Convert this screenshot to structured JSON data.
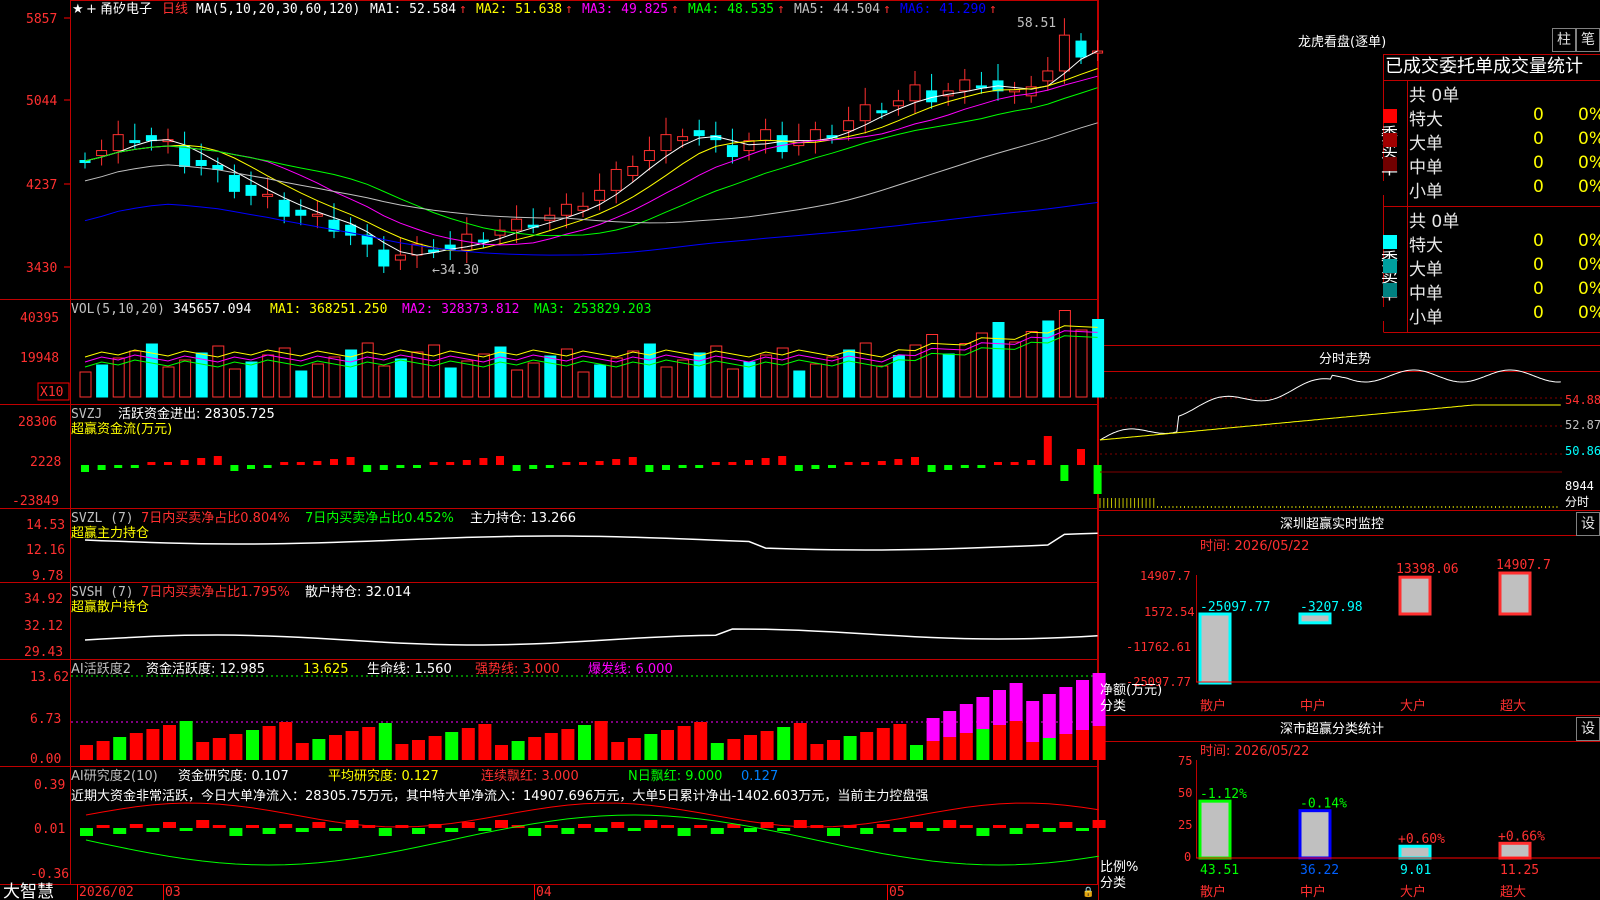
{
  "main": {
    "stock_name": "甬矽电子",
    "period": "日线",
    "indicator_label": "MA(5,10,20,30,60,120)",
    "ma": [
      {
        "label": "MA1: 52.584",
        "color": "#ffffff"
      },
      {
        "label": "MA2: 51.638",
        "color": "#ffff00"
      },
      {
        "label": "MA3: 49.825",
        "color": "#ff00ff"
      },
      {
        "label": "MA4: 48.535",
        "color": "#00ff00"
      },
      {
        "label": "MA5: 44.504",
        "color": "#c0c0c0"
      },
      {
        "label": "MA6: 41.290",
        "color": "#0000ff"
      }
    ],
    "y_labels": [
      "5857",
      "5044",
      "4237",
      "3430"
    ],
    "high_note": "58.51",
    "low_note": "←34.30"
  },
  "vol": {
    "title": "VOL(5,10,20)",
    "value": "345657.094",
    "ma": [
      {
        "label": "MA1: 368251.250",
        "color": "#ffff00"
      },
      {
        "label": "MA2: 328373.812",
        "color": "#ff00ff"
      },
      {
        "label": "MA3: 253829.203",
        "color": "#00ff00"
      }
    ],
    "y_labels": [
      "40395",
      "19948"
    ],
    "unit": "X10"
  },
  "svzj": {
    "title": "SVZJ",
    "label": "活跃资金进出: 28305.725",
    "subtitle": "超赢资金流(万元)",
    "y_labels": [
      "28306",
      "2228",
      "-23849"
    ]
  },
  "svzl": {
    "title": "SVZL (7)",
    "part1": "7日内买卖净占比0.804%",
    "part2": "7日内买卖净占比0.452%",
    "part3": "主力持仓: 13.266",
    "subtitle": "超赢主力持仓",
    "y_labels": [
      "14.53",
      "12.16",
      "9.78"
    ]
  },
  "svsh": {
    "title": "SVSH (7)",
    "part1": "7日内买卖净占比1.795%",
    "part2": "散户持仓: 32.014",
    "subtitle": "超赢散户持仓",
    "y_labels": [
      "34.92",
      "32.12",
      "29.43"
    ]
  },
  "ai1": {
    "title": "AI活跃度2",
    "p1": "资金活跃度: 12.985",
    "p2": "13.625",
    "p3": "生命线: 1.560",
    "p4": "强势线: 3.000",
    "p5": "爆发线: 6.000",
    "y_labels": [
      "13.62",
      "6.73",
      "0.00"
    ]
  },
  "ai2": {
    "title": "AI研究度2(10)",
    "p1": "资金研究度: 0.107",
    "p2": "平均研究度: 0.127",
    "p3": "连续飘红: 3.000",
    "p4": "N日飘红: 9.000",
    "p5": "0.127",
    "summary": "近期大资金非常活跃，今日大单净流入：28305.75万元，其中特大单净流入：14907.696万元，大单5日累计净出-1402.603万元，当前主力控盘强",
    "y_labels": [
      "0.39",
      "0.01",
      "-0.36"
    ]
  },
  "x_axis": {
    "brand": "大智慧",
    "labels": [
      "2026/02",
      "03",
      "04",
      "05"
    ]
  },
  "longhu": {
    "title": "龙虎看盘(逐单)",
    "btn1": "柱",
    "btn2": "笔",
    "header": "已成交委托单成交量统计",
    "buy_label": "委买单",
    "sell_label": "委卖单",
    "buy_total": "共 0单",
    "sell_total": "共 0单",
    "buy_rows": [
      {
        "name": "特大",
        "count": "0",
        "pct": "0%",
        "color": "#ff0000"
      },
      {
        "name": "大单",
        "count": "0",
        "pct": "0%",
        "color": "#a00000"
      },
      {
        "name": "中单",
        "count": "0",
        "pct": "0%",
        "color": "#700000"
      },
      {
        "name": "小单",
        "count": "0",
        "pct": "0%",
        "color": "#000000"
      }
    ],
    "sell_rows": [
      {
        "name": "特大",
        "count": "0",
        "pct": "0%",
        "color": "#00ffff"
      },
      {
        "name": "大单",
        "count": "0",
        "pct": "0%",
        "color": "#00a0a0"
      },
      {
        "name": "中单",
        "count": "0",
        "pct": "0%",
        "color": "#008080"
      },
      {
        "name": "小单",
        "count": "0",
        "pct": "0%",
        "color": "#000000"
      }
    ]
  },
  "intraday": {
    "title": "分时走势",
    "y_labels": [
      "54.88",
      "52.87",
      "50.86"
    ],
    "vol_label": "8944",
    "time_label": "分时"
  },
  "sz_monitor": {
    "title": "深圳超赢实时监控",
    "settings": "设",
    "time": "时间: 2026/05/22",
    "y_labels": [
      "14907.7",
      "1572.54",
      "-11762.61",
      "-25097.77"
    ],
    "net_label": "净额(万元)",
    "cat_label": "分类",
    "bars": [
      {
        "cat": "散户",
        "value": "-25097.77",
        "num": -25097.77
      },
      {
        "cat": "中户",
        "value": "-3207.98",
        "num": -3207.98
      },
      {
        "cat": "大户",
        "value": "13398.06",
        "num": 13398.06
      },
      {
        "cat": "超大",
        "value": "14907.7",
        "num": 14907.7
      }
    ]
  },
  "sz_class": {
    "title": "深市超赢分类统计",
    "settings": "设",
    "time": "时间: 2026/05/22",
    "y_labels": [
      "75",
      "50",
      "25",
      "0"
    ],
    "ratio_label": "比例%",
    "cat_label": "分类",
    "bars": [
      {
        "cat": "散户",
        "change": "-1.12%",
        "value": "43.51",
        "num": 43.51
      },
      {
        "cat": "中户",
        "change": "-0.14%",
        "value": "36.22",
        "num": 36.22
      },
      {
        "cat": "大户",
        "change": "+0.60%",
        "value": "9.01",
        "num": 9.01
      },
      {
        "cat": "超大",
        "change": "+0.66%",
        "value": "11.25",
        "num": 11.25
      }
    ]
  }
}
